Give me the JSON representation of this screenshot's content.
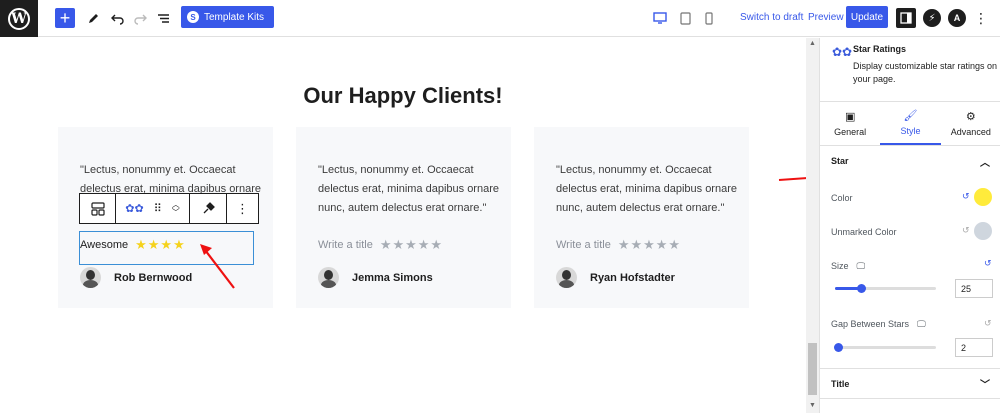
{
  "topbar": {
    "template_kits": "Template Kits",
    "switch_to_draft": "Switch to draft",
    "preview": "Preview",
    "update": "Update"
  },
  "canvas": {
    "headline": "Our Happy Clients!",
    "cards": [
      {
        "quote": "\"Lectus, nonummy et. Occaecat delectus erat, minima dapibus ornare nunc, autem delectus erat ornare.\"",
        "rating_title": "Awesome",
        "stars": "★★★★",
        "name": "Rob Bernwood"
      },
      {
        "quote": "\"Lectus, nonummy et. Occaecat delectus erat, minima dapibus ornare nunc, autem delectus erat ornare.\"",
        "rating_title": "Write a title",
        "stars": "★★★★★",
        "name": "Jemma Simons"
      },
      {
        "quote": "\"Lectus, nonummy et. Occaecat delectus erat, minima dapibus ornare nunc, autem delectus erat ornare.\"",
        "rating_title": "Write a title",
        "stars": "★★★★★",
        "name": "Ryan Hofstadter"
      }
    ]
  },
  "sidebar": {
    "block_title": "Star Ratings",
    "block_desc": "Display customizable star ratings on your page.",
    "tabs": [
      {
        "label": "General"
      },
      {
        "label": "Style"
      },
      {
        "label": "Advanced"
      }
    ],
    "star_section": "Star",
    "color_label": "Color",
    "color_value": "#ffeb3b",
    "unmarked_label": "Unmarked Color",
    "unmarked_value": "#cfd6de",
    "size_label": "Size",
    "size_value": "25",
    "gap_label": "Gap Between Stars",
    "gap_value": "2",
    "title_section": "Title"
  }
}
